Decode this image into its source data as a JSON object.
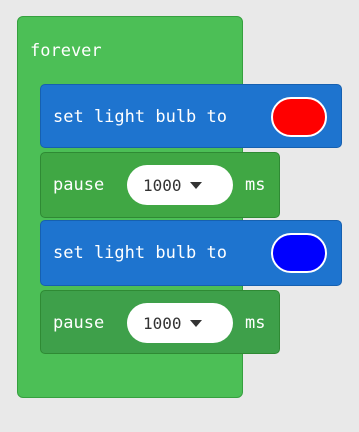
{
  "forever": {
    "label": "forever"
  },
  "blocks": [
    {
      "type": "set-light",
      "label": "set light bulb to",
      "color": "#ff0000"
    },
    {
      "type": "pause",
      "label": "pause",
      "value": "1000",
      "unit": "ms"
    },
    {
      "type": "set-light",
      "label": "set light bulb to",
      "color": "#0000ff"
    },
    {
      "type": "pause",
      "label": "pause",
      "value": "1000",
      "unit": "ms"
    }
  ],
  "colors": {
    "forever": "#4cbf56",
    "set_block": "#1e74cf",
    "pause_block": "#40a744",
    "workspace": "#e9e9e9"
  }
}
